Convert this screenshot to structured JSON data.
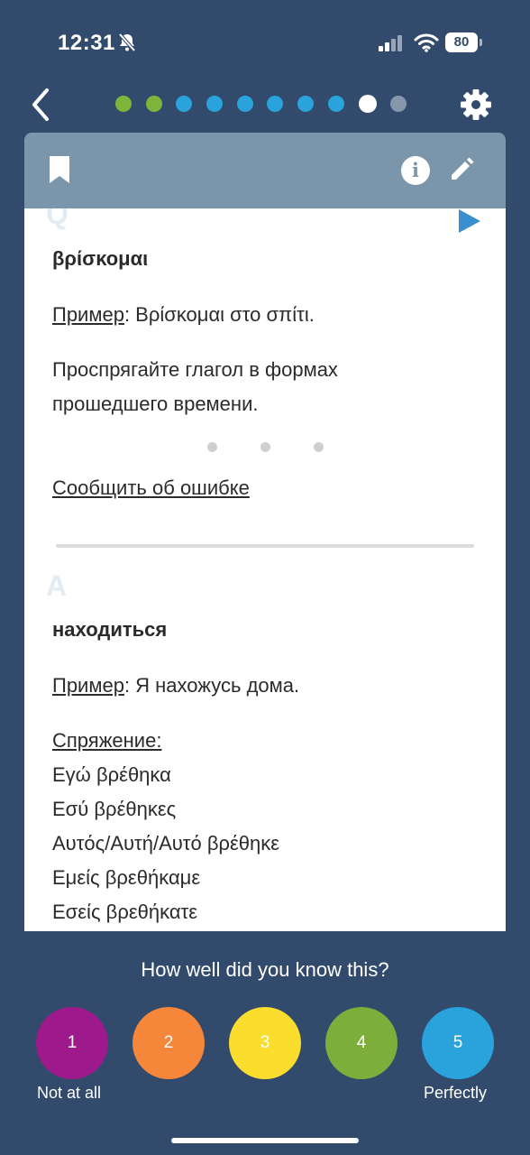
{
  "status": {
    "time": "12:31",
    "battery": "80"
  },
  "progress": {
    "dots": [
      {
        "color": "#7db53b"
      },
      {
        "color": "#7db53b"
      },
      {
        "color": "#2aa2dc"
      },
      {
        "color": "#2aa2dc"
      },
      {
        "color": "#2aa2dc"
      },
      {
        "color": "#2aa2dc"
      },
      {
        "color": "#2aa2dc"
      },
      {
        "color": "#2aa2dc"
      },
      {
        "color": "#ffffff",
        "current": true
      },
      {
        "color": "#8696ab"
      }
    ]
  },
  "question": {
    "marker": "Q",
    "word": "βρίσκομαι",
    "example_label": "Пример",
    "example_text": ": Βρίσκομαι στο σπίτι.",
    "task_line1": "Проспрягайте глагол в формах",
    "task_line2": "прошедшего времени.",
    "report_link": "Сообщить об ошибке"
  },
  "answer": {
    "marker": "A",
    "word": "находиться",
    "example_label": "Пример",
    "example_text": ": Я нахожусь дома.",
    "conjugation_label": "Спряжение:",
    "conjugation": [
      "Εγώ βρέθηκα",
      "Εσύ βρέθηκες",
      "Αυτός/Αυτή/Αυτό βρέθηκε",
      "Εμείς βρεθήκαμε",
      "Εσείς βρεθήκατε"
    ]
  },
  "rating": {
    "prompt": "How well did you know this?",
    "buttons": [
      {
        "label": "1",
        "color": "#9e1a8c"
      },
      {
        "label": "2",
        "color": "#f6873a"
      },
      {
        "label": "3",
        "color": "#fbdd2e"
      },
      {
        "label": "4",
        "color": "#7dad3a"
      },
      {
        "label": "5",
        "color": "#2aa2dc"
      }
    ],
    "low_label": "Not at all",
    "high_label": "Perfectly"
  }
}
